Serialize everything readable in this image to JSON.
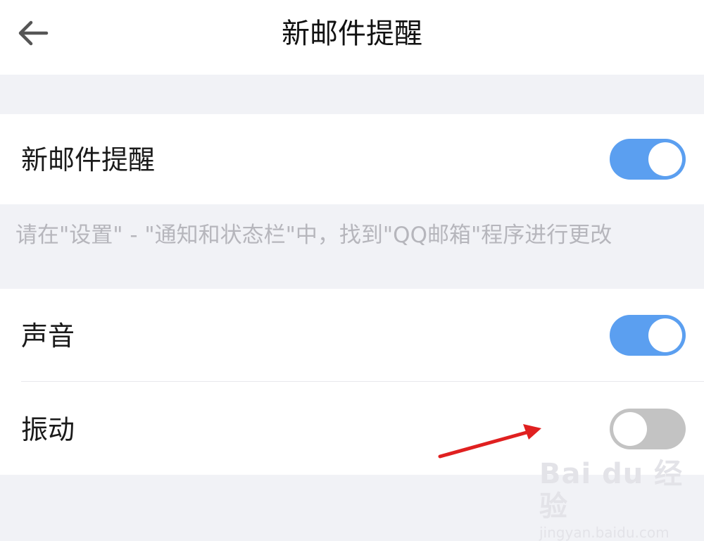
{
  "header": {
    "title": "新邮件提醒",
    "back_icon": "arrow-left-icon"
  },
  "settings": {
    "new_mail": {
      "label": "新邮件提醒",
      "enabled": true
    },
    "hint": "请在\"设置\" - \"通知和状态栏\"中，找到\"QQ邮箱\"程序进行更改",
    "sound": {
      "label": "声音",
      "enabled": true
    },
    "vibration": {
      "label": "振动",
      "enabled": false
    }
  },
  "colors": {
    "toggle_on": "#5b9ff0",
    "toggle_off": "#c3c3c3",
    "annotation_arrow": "#e02020"
  },
  "watermark": {
    "brand": "Bai du 经验",
    "url": "jingyan.baidu.com"
  }
}
